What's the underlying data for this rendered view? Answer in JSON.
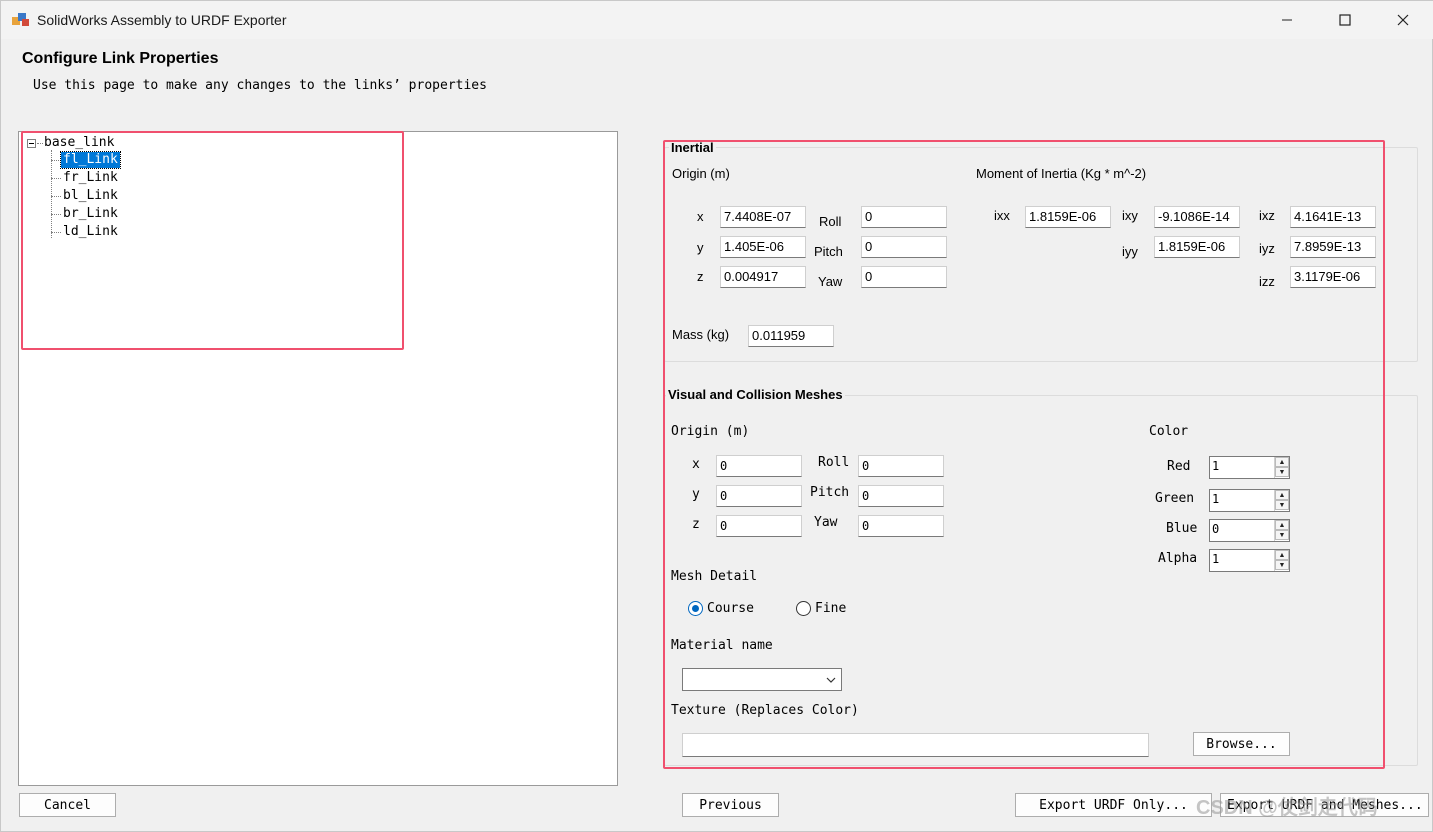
{
  "window": {
    "title": "SolidWorks Assembly to URDF Exporter"
  },
  "page": {
    "heading": "Configure Link Properties",
    "subheading": "Use this page to make any changes to the links’ properties"
  },
  "tree": {
    "root": "base_link",
    "children": [
      "fl_Link",
      "fr_Link",
      "bl_Link",
      "br_Link",
      "ld_Link"
    ],
    "selected": "fl_Link"
  },
  "inertial": {
    "group_title": "Inertial",
    "origin_label": "Origin (m)",
    "moi_label": "Moment of Inertia (Kg * m^-2)",
    "x_label": "x",
    "y_label": "y",
    "z_label": "z",
    "x": "7.4408E-07",
    "y": "1.405E-06",
    "z": "0.004917",
    "roll_label": "Roll",
    "pitch_label": "Pitch",
    "yaw_label": "Yaw",
    "roll": "0",
    "pitch": "0",
    "yaw": "0",
    "ixx_label": "ixx",
    "ixy_label": "ixy",
    "ixz_label": "ixz",
    "iyy_label": "iyy",
    "iyz_label": "iyz",
    "izz_label": "izz",
    "ixx": "1.8159E-06",
    "ixy": "-9.1086E-14",
    "ixz": "4.1641E-13",
    "iyy": "1.8159E-06",
    "iyz": "7.8959E-13",
    "izz": "3.1179E-06",
    "mass_label": "Mass (kg)",
    "mass": "0.011959"
  },
  "visual": {
    "group_title": "Visual and Collision Meshes",
    "origin_label": "Origin (m)",
    "x_label": "x",
    "y_label": "y",
    "z_label": "z",
    "x": "0",
    "y": "0",
    "z": "0",
    "roll_label": "Roll",
    "pitch_label": "Pitch",
    "yaw_label": "Yaw",
    "roll": "0",
    "pitch": "0",
    "yaw": "0",
    "color_label": "Color",
    "red_label": "Red",
    "green_label": "Green",
    "blue_label": "Blue",
    "alpha_label": "Alpha",
    "red": "1",
    "green": "1",
    "blue": "0",
    "alpha": "1",
    "mesh_detail_label": "Mesh Detail",
    "course_label": "Course",
    "fine_label": "Fine",
    "mesh_detail_selected": "Course",
    "material_label": "Material name",
    "material_value": "",
    "texture_label": "Texture (Replaces Color)",
    "texture_value": "",
    "browse_label": "Browse..."
  },
  "footer": {
    "cancel": "Cancel",
    "previous": "Previous",
    "export_urdf_only": "Export URDF Only...",
    "export_urdf_meshes": "Export URDF and Meshes..."
  },
  "watermark": "CSDN @仗剑走代码",
  "colors": {
    "selection": "#0078d7",
    "highlight_box": "#f0506e",
    "radio_accent": "#0067c0"
  }
}
